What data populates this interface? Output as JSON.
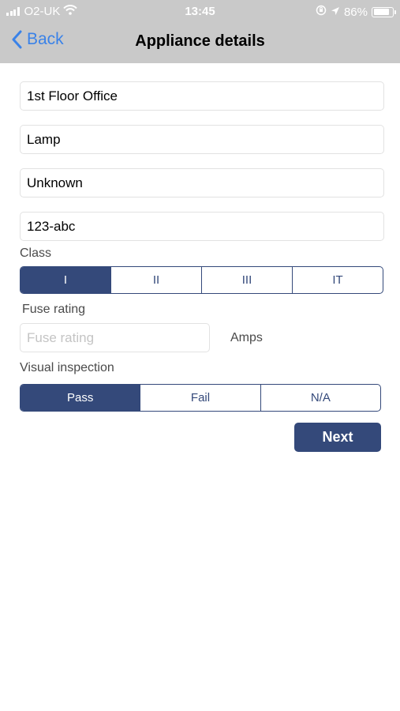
{
  "status_bar": {
    "carrier": "O2-UK",
    "time": "13:45",
    "battery": "86%",
    "battery_level": 0.86,
    "icons": [
      "signal-icon",
      "wifi-icon",
      "orientation-lock-icon",
      "location-icon",
      "battery-icon"
    ]
  },
  "nav": {
    "back_label": "Back",
    "title": "Appliance details"
  },
  "form": {
    "location": {
      "value": "1st Floor Office"
    },
    "appliance": {
      "value": "Lamp"
    },
    "make": {
      "value": "Unknown"
    },
    "serial": {
      "value": "123-abc"
    },
    "class": {
      "label": "Class",
      "options": [
        "I",
        "II",
        "III",
        "IT"
      ],
      "selected": "I"
    },
    "fuse": {
      "label": "Fuse rating",
      "placeholder": "Fuse rating",
      "value": "",
      "unit": "Amps"
    },
    "visual_inspection": {
      "label": "Visual inspection",
      "options": [
        "Pass",
        "Fail",
        "N/A"
      ],
      "selected": "Pass"
    }
  },
  "actions": {
    "next_label": "Next"
  },
  "colors": {
    "accent": "#34497a",
    "link": "#3a82e8",
    "header_bg": "#c9c9c9"
  }
}
